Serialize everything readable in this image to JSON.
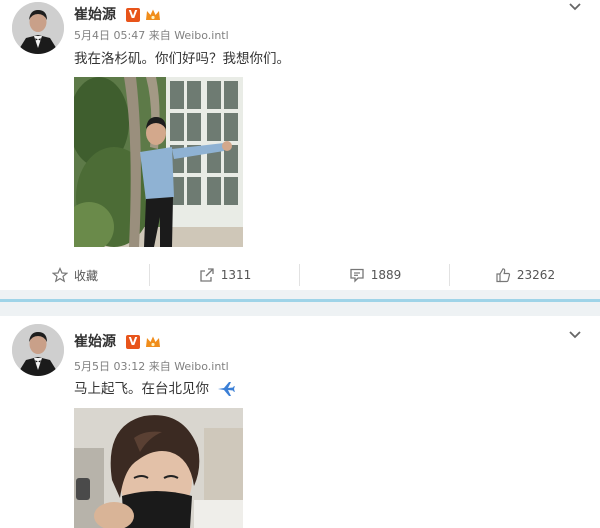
{
  "posts": [
    {
      "username": "崔始源",
      "verified_badge": "V",
      "timestamp": "5月4日 05:47",
      "source": "来自 Weibo.intl",
      "text": "我在洛杉矶。你们好吗？我想你们。",
      "actions": {
        "favorite_label": "收藏",
        "repost_count": "1311",
        "comment_count": "1889",
        "like_count": "23262"
      }
    },
    {
      "username": "崔始源",
      "verified_badge": "V",
      "timestamp": "5月5日 03:12",
      "source": "来自 Weibo.intl",
      "text": "马上起飞。在台北见你"
    }
  ],
  "colors": {
    "accent_band": "#9fd4e8",
    "verified_badge": "#e8541a",
    "meta_text": "#808080"
  },
  "icons": [
    "avatar",
    "verified-badge-icon",
    "crown-icon",
    "chevron-down-icon",
    "star-icon",
    "repost-icon",
    "comment-icon",
    "like-icon",
    "airplane-icon"
  ]
}
